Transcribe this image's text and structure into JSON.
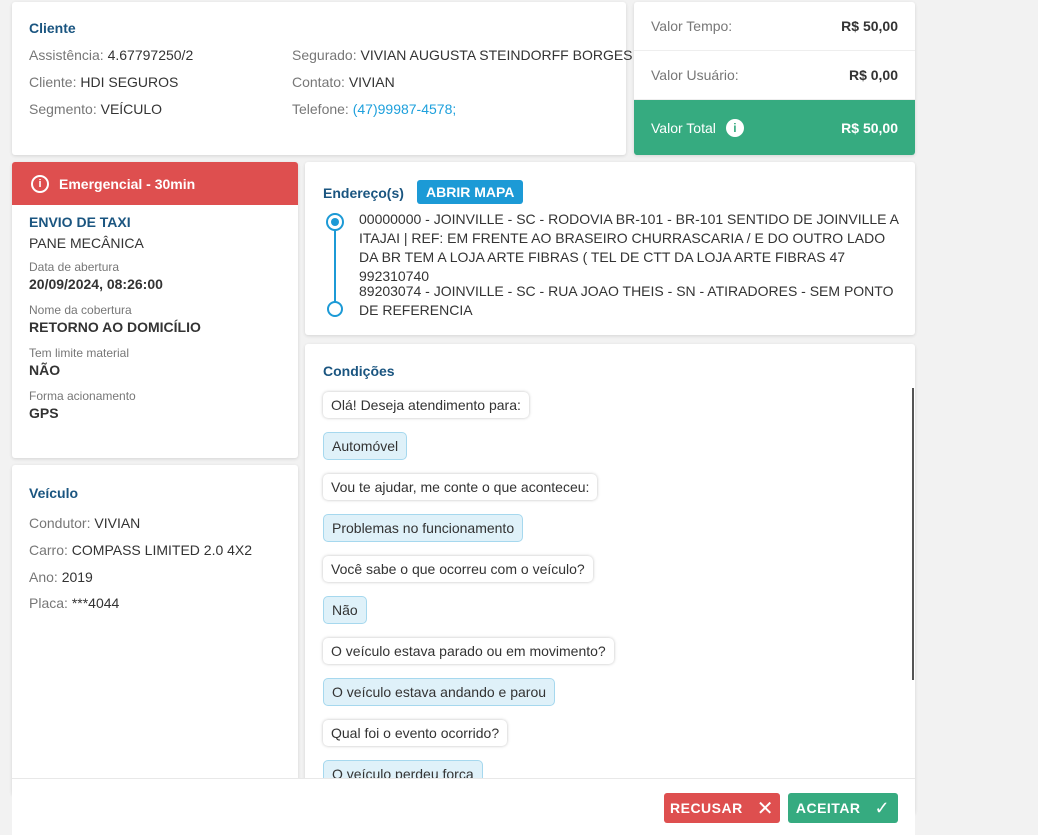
{
  "cliente": {
    "title": "Cliente",
    "fields": [
      {
        "label": "Assistência:",
        "value": "4.67797250/2"
      },
      {
        "label": "Cliente:",
        "value": "HDI SEGUROS"
      },
      {
        "label": "Segmento:",
        "value": "VEÍCULO"
      },
      {
        "label": "Segurado:",
        "value": "VIVIAN AUGUSTA STEINDORFF BORGES"
      },
      {
        "label": "Contato:",
        "value": "VIVIAN"
      },
      {
        "label": "Telefone:",
        "value": "(47)99987-4578;"
      }
    ]
  },
  "valores": {
    "tempo_label": "Valor Tempo:",
    "tempo": "R$ 50,00",
    "usuario_label": "Valor Usuário:",
    "usuario": "R$ 0,00",
    "total_label": "Valor Total",
    "total": "R$ 50,00",
    "total_color": "#36ab80"
  },
  "servico": {
    "priority": "Emergencial - 30min",
    "priority_color": "#de4f4f",
    "type": "ENVIO DE TAXI",
    "problem": "PANE MECÂNICA",
    "fields": [
      {
        "label": "Data de abertura",
        "value": "20/09/2024, 08:26:00"
      },
      {
        "label": "Nome da cobertura",
        "value": "RETORNO AO DOMICÍLIO"
      },
      {
        "label": "Tem limite material",
        "value": "NÃO"
      },
      {
        "label": "Forma acionamento",
        "value": "GPS"
      }
    ]
  },
  "veiculo": {
    "title": "Veículo",
    "fields": [
      {
        "label": "Condutor:",
        "value": "VIVIAN"
      },
      {
        "label": "Carro:",
        "value": "COMPASS LIMITED 2.0 4X2"
      },
      {
        "label": "Ano:",
        "value": "2019"
      },
      {
        "label": "Placa:",
        "value": "***4044"
      }
    ]
  },
  "enderecos": {
    "title": "Endereço(s)",
    "map_button": "ABRIR MAPA",
    "items": [
      "00000000 - JOINVILLE - SC - RODOVIA BR-101 - BR-101 SENTIDO DE JOINVILLE A ITAJAI | REF: EM FRENTE AO BRASEIRO CHURRASCARIA / E DO OUTRO LADO DA BR TEM A LOJA ARTE FIBRAS ( TEL DE CTT DA LOJA ARTE FIBRAS 47 992310740",
      "89203074 - JOINVILLE - SC - RUA JOAO THEIS - SN - ATIRADORES - SEM PONTO DE REFERENCIA"
    ]
  },
  "condicoes": {
    "title": "Condições",
    "messages": [
      {
        "type": "q",
        "text": "Olá! Deseja atendimento para:"
      },
      {
        "type": "a",
        "text": "Automóvel"
      },
      {
        "type": "q",
        "text": "Vou te ajudar, me conte o que aconteceu:"
      },
      {
        "type": "a",
        "text": "Problemas no funcionamento"
      },
      {
        "type": "q",
        "text": "Você sabe o que ocorreu com o veículo?"
      },
      {
        "type": "a",
        "text": "Não"
      },
      {
        "type": "q",
        "text": "O veículo estava parado ou em movimento?"
      },
      {
        "type": "a",
        "text": "O veículo estava andando e parou"
      },
      {
        "type": "q",
        "text": "Qual foi o evento ocorrido?"
      },
      {
        "type": "a",
        "text": "O veículo perdeu força"
      }
    ]
  },
  "actions": {
    "recusar": "RECUSAR",
    "aceitar": "ACEITAR"
  }
}
